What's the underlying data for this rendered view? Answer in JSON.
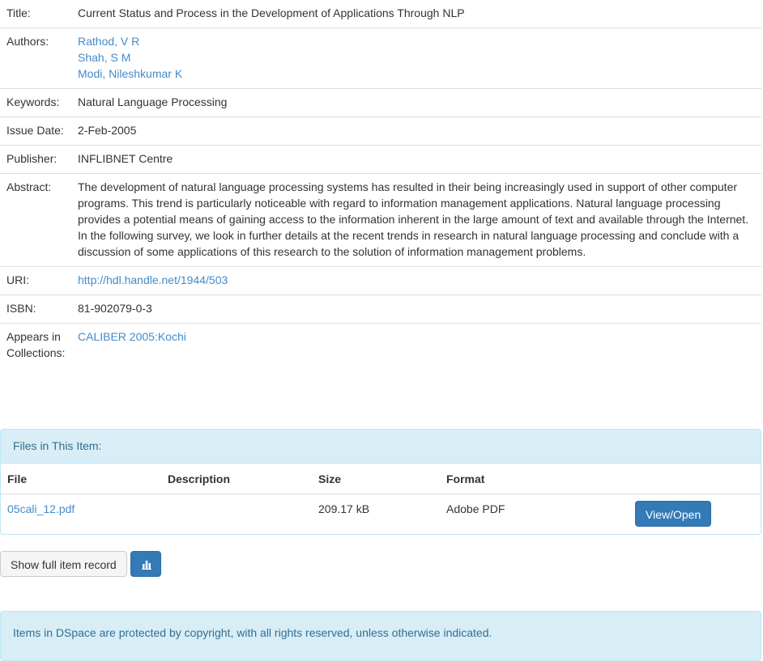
{
  "metadata": {
    "title_label": "Title:",
    "title": "Current Status and Process in the Development of Applications Through NLP",
    "authors_label": "Authors:",
    "authors": [
      "Rathod, V R",
      "Shah, S M",
      "Modi, Nileshkumar K"
    ],
    "keywords_label": "Keywords:",
    "keywords": "Natural Language Processing",
    "issue_date_label": "Issue Date:",
    "issue_date": "2-Feb-2005",
    "publisher_label": "Publisher:",
    "publisher": "INFLIBNET Centre",
    "abstract_label": "Abstract:",
    "abstract": "The development of natural language processing systems has resulted in their being increasingly used in support of other computer programs. This trend is particularly noticeable with regard to information management applications. Natural language processing provides a potential means of gaining access to the information inherent in the large amount of text and available through the Internet. In the following survey, we look in further details at the recent trends in research in natural language processing and conclude with a discussion of some applications of this research to the solution of information management problems.",
    "uri_label": "URI:",
    "uri": "http://hdl.handle.net/1944/503",
    "isbn_label": "ISBN:",
    "isbn": "81-902079-0-3",
    "collections_label": "Appears in Collections:",
    "collection": "CALIBER 2005:Kochi"
  },
  "files": {
    "heading": "Files in This Item:",
    "columns": [
      "File",
      "Description",
      "Size",
      "Format"
    ],
    "rows": [
      {
        "file": "05cali_12.pdf",
        "description": "",
        "size": "209.17 kB",
        "format": "Adobe PDF",
        "action": "View/Open"
      }
    ]
  },
  "actions": {
    "full_record_label": "Show full item record",
    "stats_icon": "bar-chart-icon"
  },
  "footer": {
    "notice": "Items in DSpace are protected by copyright, with all rights reserved, unless otherwise indicated."
  },
  "colors": {
    "link": "#428bca",
    "primary": "#337ab7",
    "info_bg": "#d9edf7",
    "info_text": "#31708f"
  }
}
